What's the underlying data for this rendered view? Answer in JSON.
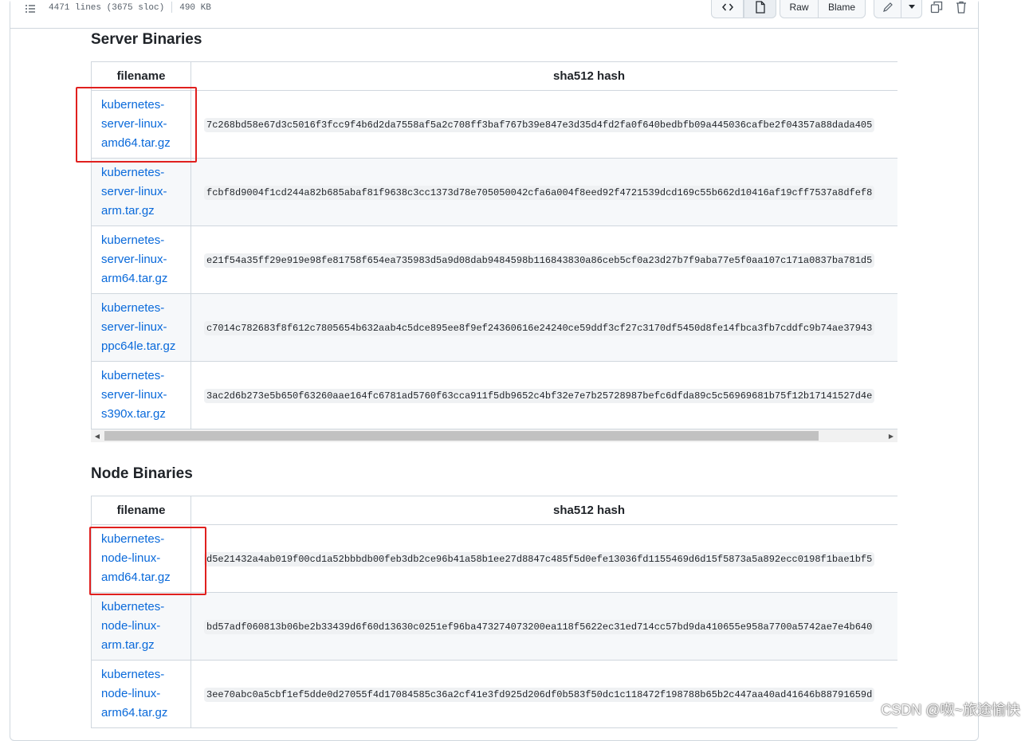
{
  "header": {
    "lines": "4471 lines (3675 sloc)",
    "size": "490 KB",
    "raw_label": "Raw",
    "blame_label": "Blame"
  },
  "server": {
    "title": "Server Binaries",
    "col_filename": "filename",
    "col_hash": "sha512 hash",
    "rows": [
      {
        "file": "kubernetes-server-linux-amd64.tar.gz",
        "lines": [
          "kubernetes-",
          "server-linux-",
          "amd64.tar.gz"
        ],
        "hash": "7c268bd58e67d3c5016f3fcc9f4b6d2da7558af5a2c708ff3baf767b39e847e3d35d4fd2fa0f640bedbfb09a445036cafbe2f04357a88dada405"
      },
      {
        "file": "kubernetes-server-linux-arm.tar.gz",
        "lines": [
          "kubernetes-",
          "server-linux-",
          "arm.tar.gz"
        ],
        "hash": "fcbf8d9004f1cd244a82b685abaf81f9638c3cc1373d78e705050042cfa6a004f8eed92f4721539dcd169c55b662d10416af19cff7537a8dfef8"
      },
      {
        "file": "kubernetes-server-linux-arm64.tar.gz",
        "lines": [
          "kubernetes-",
          "server-linux-",
          "arm64.tar.gz"
        ],
        "hash": "e21f54a35ff29e919e98fe81758f654ea735983d5a9d08dab9484598b116843830a86ceb5cf0a23d27b7f9aba77e5f0aa107c171a0837ba781d5"
      },
      {
        "file": "kubernetes-server-linux-ppc64le.tar.gz",
        "lines": [
          "kubernetes-",
          "server-linux-",
          "ppc64le.tar.gz"
        ],
        "hash": "c7014c782683f8f612c7805654b632aab4c5dce895ee8f9ef24360616e24240ce59ddf3cf27c3170df5450d8fe14fbca3fb7cddfc9b74ae37943"
      },
      {
        "file": "kubernetes-server-linux-s390x.tar.gz",
        "lines": [
          "kubernetes-",
          "server-linux-",
          "s390x.tar.gz"
        ],
        "hash": "3ac2d6b273e5b650f63260aae164fc6781ad5760f63cca911f5db9652c4bf32e7e7b25728987befc6dfda89c5c56969681b75f12b17141527d4e"
      }
    ]
  },
  "node": {
    "title": "Node Binaries",
    "col_filename": "filename",
    "col_hash": "sha512 hash",
    "rows": [
      {
        "file": "kubernetes-node-linux-amd64.tar.gz",
        "lines": [
          "kubernetes-",
          "node-linux-",
          "amd64.tar.gz"
        ],
        "hash": "d5e21432a4ab019f00cd1a52bbbdb00feb3db2ce96b41a58b1ee27d8847c485f5d0efe13036fd1155469d6d15f5873a5a892ecc0198f1bae1bf5"
      },
      {
        "file": "kubernetes-node-linux-arm.tar.gz",
        "lines": [
          "kubernetes-",
          "node-linux-",
          "arm.tar.gz"
        ],
        "hash": "bd57adf060813b06be2b33439d6f60d13630c0251ef96ba473274073200ea118f5622ec31ed714cc57bd9da410655e958a7700a5742ae7e4b640"
      },
      {
        "file": "kubernetes-node-linux-arm64.tar.gz",
        "lines": [
          "kubernetes-",
          "node-linux-",
          "arm64.tar.gz"
        ],
        "hash": "3ee70abc0a5cbf1ef5dde0d27055f4d17084585c36a2cf41e3fd925d206df0b583f50dc1c118472f198788b65b2c447aa40ad41646b88791659d"
      }
    ]
  },
  "watermark": "CSDN @呶~旅途愉快",
  "colors": {
    "link": "#0969da",
    "highlight": "#e0201e",
    "border": "#d0d7de",
    "alt_row": "#f6f8fa"
  },
  "icons": [
    "list-icon",
    "code-icon",
    "file-icon",
    "pencil-icon",
    "triangle-down-icon",
    "copy-icon",
    "trash-icon"
  ]
}
